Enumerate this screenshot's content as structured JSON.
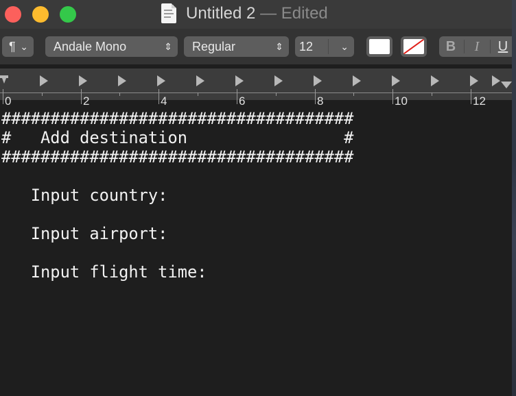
{
  "window": {
    "title": "Untitled 2",
    "edited_label": "— Edited",
    "doc_icon": "text-document-icon"
  },
  "toolbar": {
    "paragraph_symbol": "¶",
    "font_name": "Andale Mono",
    "font_style": "Regular",
    "font_size": "12",
    "text_color": "#ffffff",
    "bold_label": "B",
    "italic_label": "I",
    "underline_label": "U"
  },
  "ruler": {
    "labels": [
      "0",
      "2",
      "4",
      "6",
      "8",
      "10",
      "12"
    ]
  },
  "document": {
    "lines": [
      "####################################",
      "#   Add destination                #",
      "####################################",
      "",
      "   Input country:",
      "",
      "   Input airport:",
      "",
      "   Input flight time:"
    ]
  }
}
